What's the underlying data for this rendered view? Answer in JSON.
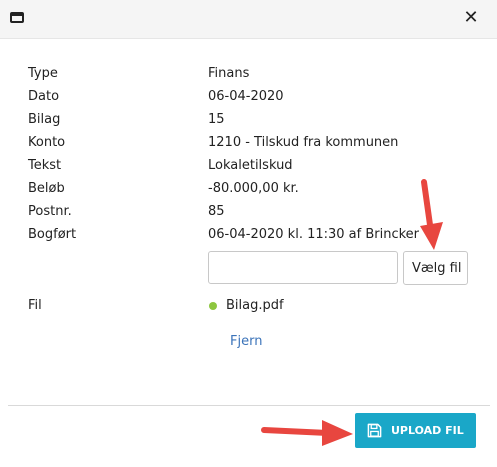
{
  "dialog": {
    "window_icon": "window-icon",
    "close_icon": "close-icon",
    "close_glyph": "✕"
  },
  "details": [
    {
      "label": "Type",
      "value": "Finans"
    },
    {
      "label": "Dato",
      "value": "06-04-2020"
    },
    {
      "label": "Bilag",
      "value": "15"
    },
    {
      "label": "Konto",
      "value": "1210 - Tilskud fra kommunen"
    },
    {
      "label": "Tekst",
      "value": "Lokaletilskud"
    },
    {
      "label": "Beløb",
      "value": "-80.000,00 kr."
    },
    {
      "label": "Postnr.",
      "value": "85"
    },
    {
      "label": "Bogført",
      "value": "06-04-2020 kl. 11:30 af Brincker"
    }
  ],
  "file_picker": {
    "input_value": "",
    "choose_label": "Vælg fil"
  },
  "attachment": {
    "label": "Fil",
    "file_name": "Bilag.pdf",
    "status_color": "#8dc63f",
    "remove_label": "Fjern"
  },
  "footer": {
    "upload_label": "UPLOAD FIL",
    "upload_icon": "save-icon",
    "button_color": "#1aa7c8"
  },
  "annotations": {
    "arrow_color": "#e8463f"
  }
}
